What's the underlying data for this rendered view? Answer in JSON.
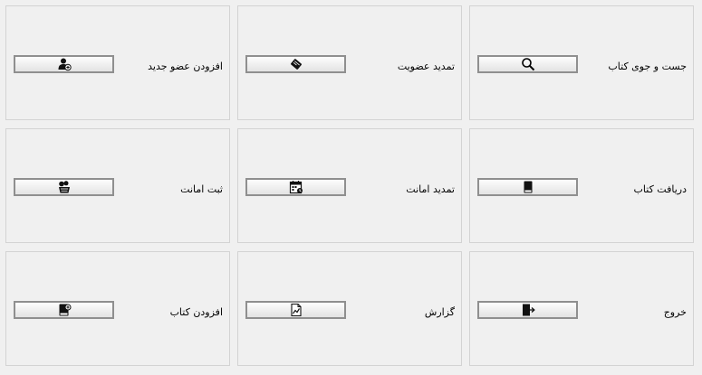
{
  "tiles": {
    "search_books": {
      "label": "جست و جوی کتاب",
      "icon": "search-icon"
    },
    "renew_membership": {
      "label": "تمدید عضویت",
      "icon": "membership-card-icon"
    },
    "add_member": {
      "label": "افزودن عضو جدید",
      "icon": "add-user-icon"
    },
    "receive_book": {
      "label": "دریافت کتاب",
      "icon": "book-icon"
    },
    "renew_loan": {
      "label": "تمدید امانت",
      "icon": "calendar-icon"
    },
    "register_loan": {
      "label": "ثبت امانت",
      "icon": "books-basket-icon"
    },
    "exit": {
      "label": "خروج",
      "icon": "exit-door-icon"
    },
    "report": {
      "label": "گزارش",
      "icon": "report-chart-icon"
    },
    "add_book": {
      "label": "افزودن کتاب",
      "icon": "add-book-icon"
    }
  }
}
